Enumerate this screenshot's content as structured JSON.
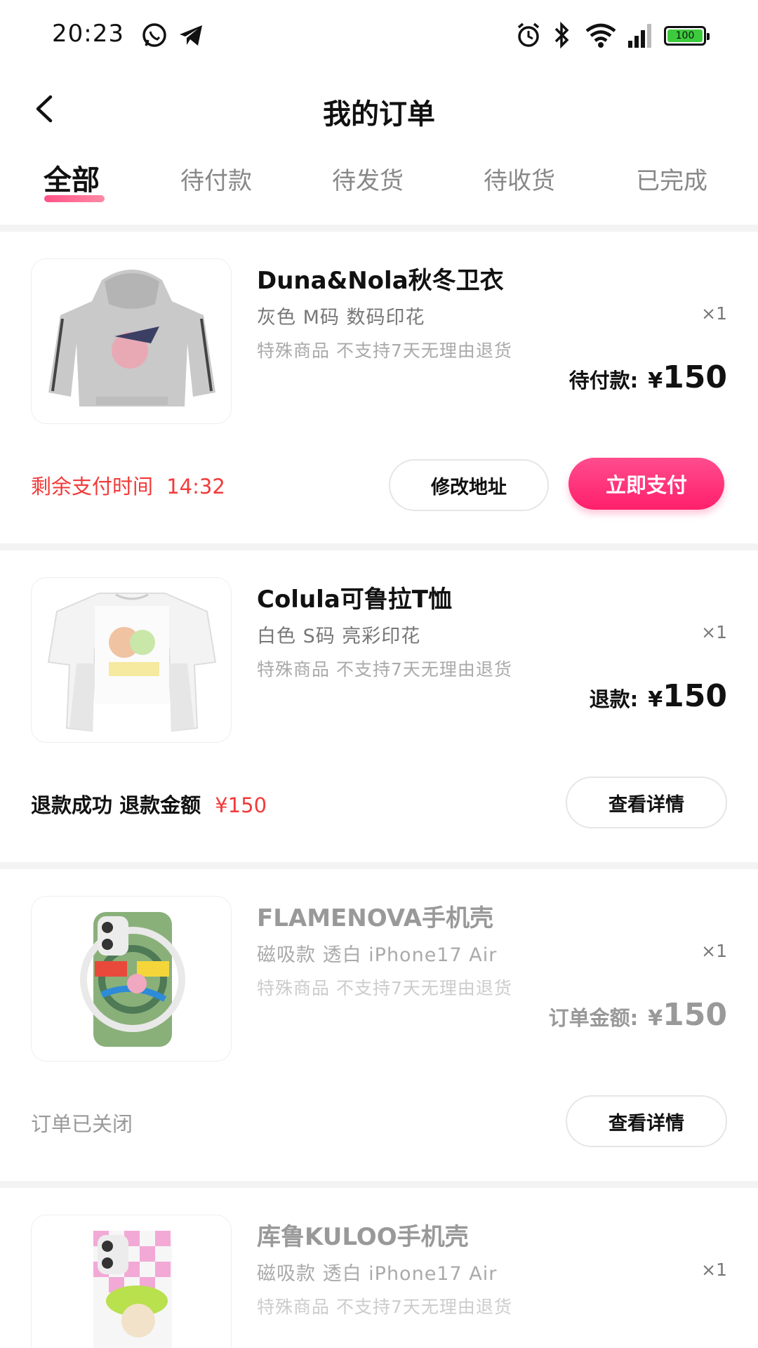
{
  "status_bar": {
    "time": "20:23",
    "battery": "100",
    "battery_color": "#3ccb3c"
  },
  "header": {
    "title": "我的订单"
  },
  "tabs": [
    {
      "label": "全部",
      "active": true
    },
    {
      "label": "待付款",
      "active": false
    },
    {
      "label": "待发货",
      "active": false
    },
    {
      "label": "待收货",
      "active": false
    },
    {
      "label": "已完成",
      "active": false
    }
  ],
  "colors": {
    "accent_pink": "#ff1f6b",
    "alert_red": "#f23a3a",
    "muted_gray": "#999999"
  },
  "orders": [
    {
      "title": "Duna&Nola秋冬卫衣",
      "spec": "灰色  M码  数码印花",
      "qty": "×1",
      "note": "特殊商品  不支持7天无理由退货",
      "price_label": "待付款:",
      "yen": "¥",
      "price": "150",
      "footer_label": "剩余支付时间",
      "countdown": "14:32",
      "btn_secondary": "修改地址",
      "btn_primary": "立即支付"
    },
    {
      "title": "Colula可鲁拉T恤",
      "spec": "白色  S码  亮彩印花",
      "qty": "×1",
      "note": "特殊商品  不支持7天无理由退货",
      "price_label": "退款:",
      "yen": "¥",
      "price": "150",
      "footer_label": "退款成功  退款金额",
      "refund_amount": "¥150",
      "btn_secondary": "查看详情"
    },
    {
      "title": "FLAMENOVA手机壳",
      "spec": "磁吸款  透白  iPhone17 Air",
      "qty": "×1",
      "note": "特殊商品  不支持7天无理由退货",
      "price_label": "订单金额:",
      "yen": "¥",
      "price": "150",
      "footer_label": "订单已关闭",
      "btn_secondary": "查看详情"
    },
    {
      "title": "库鲁KULOO手机壳",
      "spec": "磁吸款  透白  iPhone17 Air",
      "qty": "×1",
      "note": "特殊商品  不支持7天无理由退货"
    }
  ]
}
